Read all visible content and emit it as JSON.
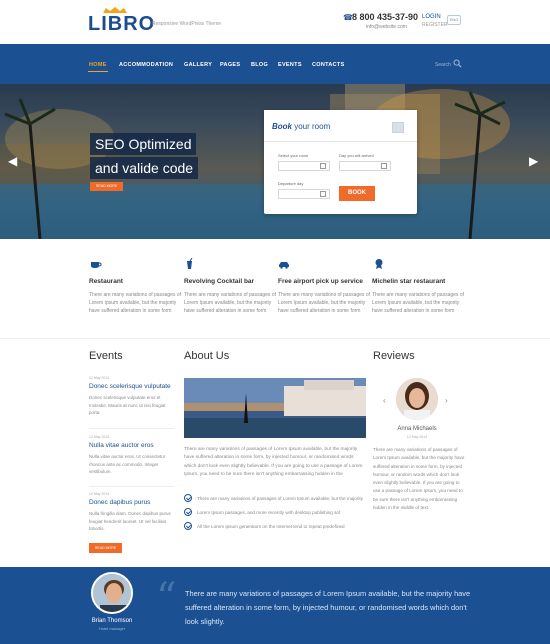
{
  "header": {
    "logo_text": "LIBRO",
    "tagline": "Responsive WordPress Theme",
    "phone": "8 800 435-37-90",
    "email": "info@website.com",
    "login": "LOGIN",
    "register": "REGISTER",
    "lang": "ENG"
  },
  "nav": {
    "items": [
      {
        "label": "HOME"
      },
      {
        "label": "ACCOMMODATION"
      },
      {
        "label": "GALLERY"
      },
      {
        "label": "PAGES"
      },
      {
        "label": "BLOG"
      },
      {
        "label": "EVENTS"
      },
      {
        "label": "CONTACTS"
      }
    ],
    "active_color": "#f6a21c",
    "search_label": "Search"
  },
  "hero": {
    "title": "SEO Optimized",
    "subtitle": "and valide code",
    "button": "READ MORE"
  },
  "booking": {
    "title_bold": "Book",
    "title_rest": "your room",
    "select_room_label": "Select your room",
    "arrival_label": "Day you will arrived",
    "departure_label": "Departure day",
    "button": "BOOK"
  },
  "features": [
    {
      "icon": "cup-icon",
      "title": "Restaurant",
      "text": "There are many variations of passages of Lorem Ipsum available, but the majority have suffered alteration in some form"
    },
    {
      "icon": "cocktail-icon",
      "title": "Revolving Cocktail bar",
      "text": "There are many variations of passages of Lorem Ipsum available, but the majority have suffered alteration in some form"
    },
    {
      "icon": "car-icon",
      "title": "Free airport pick up service",
      "text": "There are many variations of passages of Lorem Ipsum available, but the majority have suffered alteration in some form"
    },
    {
      "icon": "medal-icon",
      "title": "Michelin star restaurant",
      "text": "There are many variations of passages of Lorem Ipsum available, but the majority have suffered alteration in some form"
    }
  ],
  "events": {
    "title": "Events",
    "items": [
      {
        "date": "12 May 2014",
        "title": "Donec scelerisque vulputate",
        "text": "Donec scelerisque vulputate eros et molestie. Mauris at nunc ut nisi feugiat porta."
      },
      {
        "date": "12 May 2014",
        "title": "Nulla vitae auctor eros",
        "text": "Nulla vitae auctor eros. Ut consectetur rhoncus ante ac commodo. Integer vestibulum."
      },
      {
        "date": "12 May 2014",
        "title": "Donec dapibus purus",
        "text": "Nulla fringilla diam. Donec dapibus purus feugiat hendrerit laoreet. Ut vel facilisis lobortis."
      }
    ],
    "button": "READ MORE"
  },
  "about": {
    "title": "About Us",
    "text": "There are many variations of passages of Lorem Ipsum available, but the majority have suffered alteration in some form, by injected humour, or randomised words which don't look even slightly believable. If you are going to use a passage of Lorem Ipsum, you need to be sure there isn't anything embarrassing hidden in the",
    "bullets": [
      "There are many variations of passages of Lorem Ipsum available, but the majority",
      "Lorem Ipsum passages, and more recently with desktop publishing sof",
      "All the Lorem Ipsum generators on the Internet tend to repeat predefined"
    ]
  },
  "reviews": {
    "title": "Reviews",
    "name": "Anna Michaels",
    "date": "12 May 2014",
    "text": "There are many variations of passages of Lorem Ipsum available, but the majority have suffered alteration in some form, by injected humour, or random words which don't look even slightly believable. If you are going to use a passage of Lorem Ipsum, you need to be sure there isn't anything embarrassing hidden in the middle of text."
  },
  "testimonial": {
    "name": "Brian Thomson",
    "role": "Hotel manager",
    "quote": "There are many variations of passages of Lorem Ipsum available, but the majority have suffered alteration in some form, by injected humour, or randomised words which don't look slightly."
  }
}
